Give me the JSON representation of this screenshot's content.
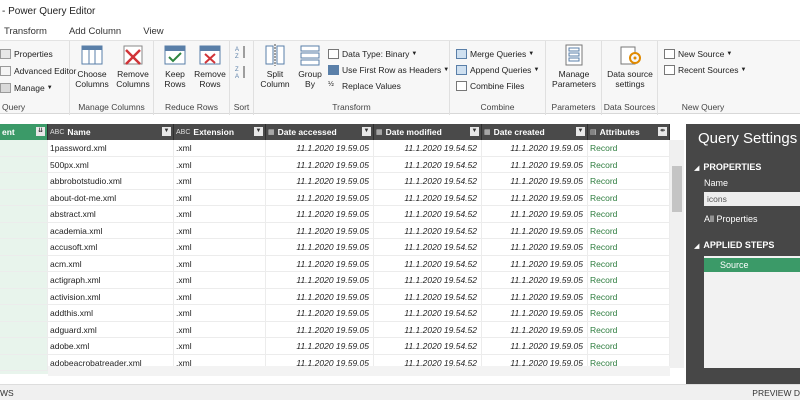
{
  "window": {
    "title": "- Power Query Editor"
  },
  "menu": {
    "tabs": [
      "Transform",
      "Add Column",
      "View"
    ]
  },
  "ribbon": {
    "query_group": {
      "label": "Query",
      "properties": "Properties",
      "advanced_editor": "Advanced Editor",
      "manage": "Manage"
    },
    "manage_columns": {
      "label": "Manage Columns",
      "choose": "Choose Columns",
      "remove": "Remove Columns"
    },
    "reduce_rows": {
      "label": "Reduce Rows",
      "keep": "Keep Rows",
      "remove": "Remove Rows"
    },
    "sort": {
      "label": "Sort"
    },
    "transform": {
      "label": "Transform",
      "split": "Split Column",
      "group": "Group By",
      "data_type": "Data Type: Binary",
      "first_row": "Use First Row as Headers",
      "replace": "Replace Values"
    },
    "combine": {
      "label": "Combine",
      "merge": "Merge Queries",
      "append": "Append Queries",
      "combine_files": "Combine Files"
    },
    "parameters": {
      "label": "Parameters",
      "manage": "Manage Parameters"
    },
    "data_sources": {
      "label": "Data Sources",
      "settings": "Data source settings"
    },
    "new_query": {
      "label": "New Query",
      "new_source": "New Source",
      "recent": "Recent Sources"
    }
  },
  "grid": {
    "first_col_header": "ent",
    "columns": [
      {
        "name": "Name",
        "type": "ABC"
      },
      {
        "name": "Extension",
        "type": "ABC"
      },
      {
        "name": "Date accessed",
        "type": "▦"
      },
      {
        "name": "Date modified",
        "type": "▦"
      },
      {
        "name": "Date created",
        "type": "▦"
      },
      {
        "name": "Attributes",
        "type": "▤"
      }
    ],
    "rows": [
      [
        "1password.xml",
        ".xml",
        "11.1.2020 19.59.05",
        "11.1.2020 19.54.52",
        "11.1.2020 19.59.05",
        "Record"
      ],
      [
        "500px.xml",
        ".xml",
        "11.1.2020 19.59.05",
        "11.1.2020 19.54.52",
        "11.1.2020 19.59.05",
        "Record"
      ],
      [
        "abbrobotstudio.xml",
        ".xml",
        "11.1.2020 19.59.05",
        "11.1.2020 19.54.52",
        "11.1.2020 19.59.05",
        "Record"
      ],
      [
        "about-dot-me.xml",
        ".xml",
        "11.1.2020 19.59.05",
        "11.1.2020 19.54.52",
        "11.1.2020 19.59.05",
        "Record"
      ],
      [
        "abstract.xml",
        ".xml",
        "11.1.2020 19.59.05",
        "11.1.2020 19.54.52",
        "11.1.2020 19.59.05",
        "Record"
      ],
      [
        "academia.xml",
        ".xml",
        "11.1.2020 19.59.05",
        "11.1.2020 19.54.52",
        "11.1.2020 19.59.05",
        "Record"
      ],
      [
        "accusoft.xml",
        ".xml",
        "11.1.2020 19.59.05",
        "11.1.2020 19.54.52",
        "11.1.2020 19.59.05",
        "Record"
      ],
      [
        "acm.xml",
        ".xml",
        "11.1.2020 19.59.05",
        "11.1.2020 19.54.52",
        "11.1.2020 19.59.05",
        "Record"
      ],
      [
        "actigraph.xml",
        ".xml",
        "11.1.2020 19.59.05",
        "11.1.2020 19.54.52",
        "11.1.2020 19.59.05",
        "Record"
      ],
      [
        "activision.xml",
        ".xml",
        "11.1.2020 19.59.05",
        "11.1.2020 19.54.52",
        "11.1.2020 19.59.05",
        "Record"
      ],
      [
        "addthis.xml",
        ".xml",
        "11.1.2020 19.59.05",
        "11.1.2020 19.54.52",
        "11.1.2020 19.59.05",
        "Record"
      ],
      [
        "adguard.xml",
        ".xml",
        "11.1.2020 19.59.05",
        "11.1.2020 19.54.52",
        "11.1.2020 19.59.05",
        "Record"
      ],
      [
        "adobe.xml",
        ".xml",
        "11.1.2020 19.59.05",
        "11.1.2020 19.54.52",
        "11.1.2020 19.59.05",
        "Record"
      ],
      [
        "adobeacrobatreader.xml",
        ".xml",
        "11.1.2020 19.59.05",
        "11.1.2020 19.54.52",
        "11.1.2020 19.59.05",
        "Record"
      ]
    ]
  },
  "query_settings": {
    "title": "Query Settings",
    "properties_label": "PROPERTIES",
    "name_label": "Name",
    "name_value": "icons",
    "all_properties": "All Properties",
    "applied_steps_label": "APPLIED STEPS",
    "steps": [
      "Source"
    ]
  },
  "status": {
    "left": "WS",
    "right": "PREVIEW D"
  },
  "colors": {
    "accent": "#3b9a68",
    "header_dark": "#4a4a4a",
    "panel": "#474747",
    "record": "#2e7d3f"
  }
}
